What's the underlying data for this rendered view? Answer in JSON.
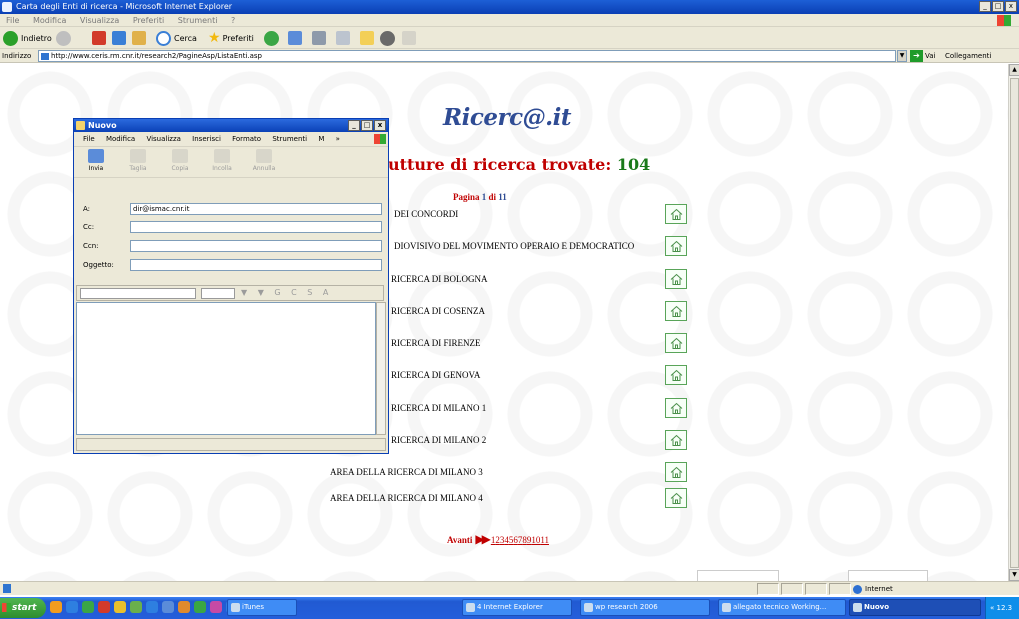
{
  "browser": {
    "title": "Carta degli Enti di ricerca - Microsoft Internet Explorer",
    "menu": [
      "File",
      "Modifica",
      "Visualizza",
      "Preferiti",
      "Strumenti",
      "?"
    ],
    "toolbar": {
      "back": "Indietro",
      "search": "Cerca",
      "favorites": "Preferiti"
    },
    "address_label": "Indirizzo",
    "address": "http://www.ceris.rm.cnr.it/research2/PagineAsp/ListaEnti.asp",
    "go": "Vai",
    "links": "Collegamenti",
    "win_min": "_",
    "win_max": "□",
    "win_close": "x",
    "dropdown": "▼",
    "go_arrow": "➔"
  },
  "page": {
    "site_title": "Ricerc@.it",
    "found_label": "utture di ricerca trovate:",
    "found_count": "104",
    "page_label": "Pagina",
    "page_current": "1",
    "page_of": "di",
    "page_total": "11",
    "entities": [
      "DEI CONCORDI",
      "DIOVISIVO DEL MOVIMENTO OPERAIO E DEMOCRATICO",
      "RICERCA DI BOLOGNA",
      "RICERCA DI COSENZA",
      "RICERCA DI FIRENZE",
      "RICERCA DI GENOVA",
      "RICERCA DI MILANO 1",
      "RICERCA DI MILANO 2",
      "AREA DELLA RICERCA DI MILANO 3",
      "AREA DELLA RICERCA DI MILANO 4"
    ],
    "pager": {
      "next_label": "Avanti",
      "arrows": "▶▶",
      "pages": [
        "1",
        "2",
        "3",
        "4",
        "5",
        "6",
        "7",
        "8",
        "9",
        "10",
        "11"
      ]
    }
  },
  "status": {
    "zone": "Internet"
  },
  "taskbar": {
    "start": "start",
    "tasks": [
      "iTunes",
      "4 Internet Explorer",
      "wp research 2006",
      "allegato tecnico Working...",
      "Nuovo"
    ],
    "clock": "« 12.3"
  },
  "mail": {
    "title": "Nuovo",
    "menu": [
      "File",
      "Modifica",
      "Visualizza",
      "Inserisci",
      "Formato",
      "Strumenti",
      "M",
      "»"
    ],
    "tools": [
      "Invia",
      "Taglia",
      "Copia",
      "Incolla",
      "Annulla"
    ],
    "to_label": "A:",
    "to_value": "dir@ismac.cnr.it",
    "cc_label": "Cc:",
    "bcc_label": "Ccn:",
    "subject_label": "Oggetto:",
    "format_glyphs": "▼ ▼ G C S A"
  },
  "colors": {
    "heading_red": "#c00000",
    "count_green": "#1a7a1a",
    "title_blue": "#2f4c94",
    "xp_blue": "#245edb"
  }
}
